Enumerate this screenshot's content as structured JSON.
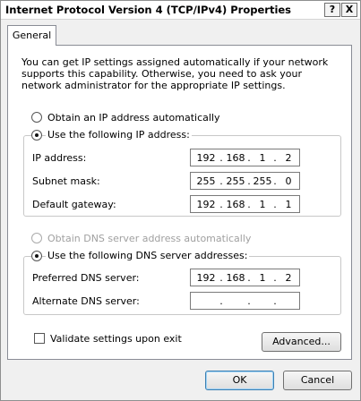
{
  "window": {
    "title": "Internet Protocol Version 4 (TCP/IPv4) Properties",
    "help_label": "?",
    "close_label": "X"
  },
  "tabs": [
    {
      "label": "General",
      "selected": true
    }
  ],
  "description": "You can get IP settings assigned automatically if your network supports this capability. Otherwise, you need to ask your network administrator for the appropriate IP settings.",
  "ip_mode": {
    "auto_label": "Obtain an IP address automatically",
    "manual_label": "Use the following IP address:",
    "selected": "manual"
  },
  "ip_fields": [
    {
      "label": "IP address:",
      "octets": [
        "192",
        "168",
        "1",
        "2"
      ]
    },
    {
      "label": "Subnet mask:",
      "octets": [
        "255",
        "255",
        "255",
        "0"
      ]
    },
    {
      "label": "Default gateway:",
      "octets": [
        "192",
        "168",
        "1",
        "1"
      ]
    }
  ],
  "dns_mode": {
    "auto_label": "Obtain DNS server address automatically",
    "manual_label": "Use the following DNS server addresses:",
    "selected": "manual",
    "auto_disabled": true
  },
  "dns_fields": [
    {
      "label": "Preferred DNS server:",
      "octets": [
        "192",
        "168",
        "1",
        "2"
      ]
    },
    {
      "label": "Alternate DNS server:",
      "octets": [
        "",
        "",
        "",
        ""
      ]
    }
  ],
  "validate": {
    "label": "Validate settings upon exit",
    "checked": false
  },
  "buttons": {
    "advanced": "Advanced...",
    "ok": "OK",
    "cancel": "Cancel"
  }
}
